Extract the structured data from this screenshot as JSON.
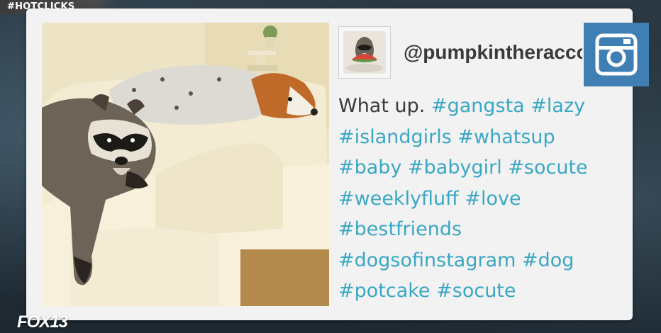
{
  "segment_tag": "#HOTCLICKS",
  "post": {
    "handle": "@pumpkintheraccoon",
    "caption_intro": "What up.",
    "hashtags": [
      "#gangsta",
      "#lazy",
      "#islandgirls",
      "#whatsup",
      "#baby",
      "#babygirl",
      "#socute",
      "#weeklyfluff",
      "#love",
      "#bestfriends",
      "#dogsofinstagram",
      "#dog",
      "#potcake",
      "#socute"
    ],
    "photo_icon": "raccoon-and-dog-on-couch-photo",
    "avatar_icon": "raccoon-with-watermelon-avatar"
  },
  "badge_icon": "instagram-camera-icon",
  "station_logo": "FOX13",
  "colors": {
    "hashtag": "#3aa7c4",
    "badge": "#3f7fb4",
    "card": "#f2f2f2"
  }
}
